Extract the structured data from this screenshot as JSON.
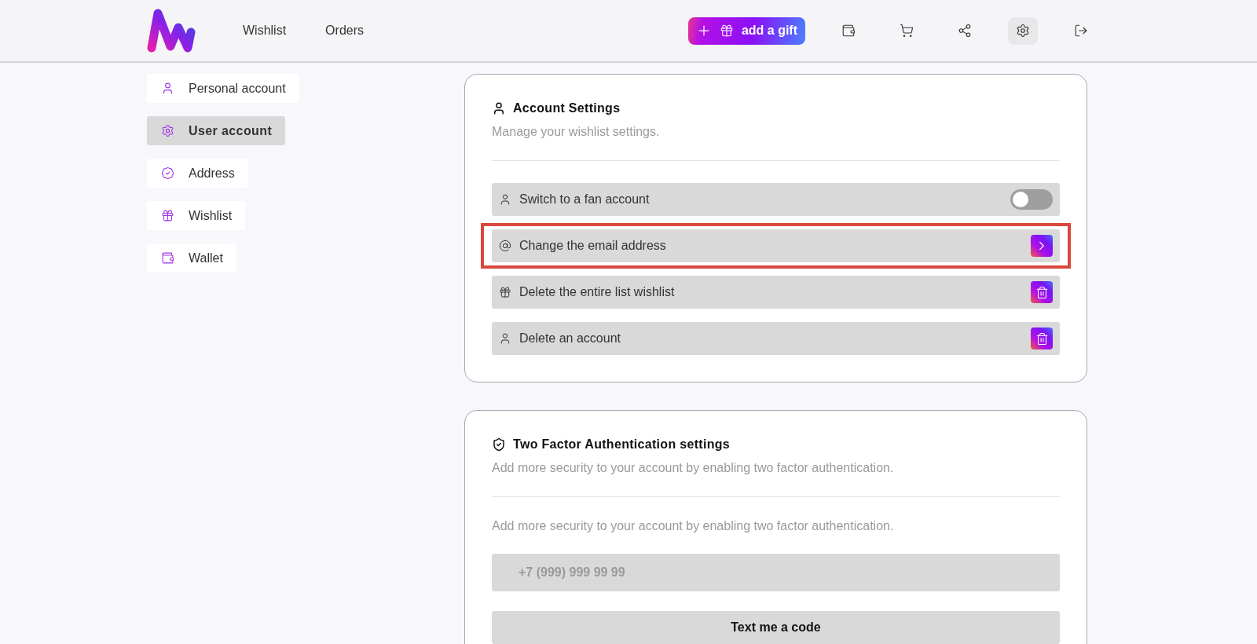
{
  "header": {
    "nav": [
      {
        "label": "Wishlist"
      },
      {
        "label": "Orders"
      }
    ],
    "add_button": {
      "label": "add a gift"
    },
    "toolbar": [
      {
        "kind": "wallet",
        "selected": false
      },
      {
        "kind": "cart",
        "selected": false
      },
      {
        "kind": "share",
        "selected": false
      },
      {
        "kind": "settings",
        "selected": true
      },
      {
        "kind": "logout",
        "selected": false
      }
    ]
  },
  "sidebar": {
    "items": [
      {
        "kind": "user",
        "label": "Personal account",
        "selected": false
      },
      {
        "kind": "settings",
        "label": "User account",
        "selected": true
      },
      {
        "kind": "badge",
        "label": "Address",
        "selected": false
      },
      {
        "kind": "gift",
        "label": "Wishlist",
        "selected": false
      },
      {
        "kind": "wallet",
        "label": "Wallet",
        "selected": false
      }
    ]
  },
  "account_settings": {
    "title": "Account Settings",
    "subtitle": "Manage your wishlist settings.",
    "rows": [
      {
        "kind": "toggle",
        "label": "Switch to a fan account",
        "on": false,
        "highlighted": false
      },
      {
        "kind": "arrow",
        "label": "Change the email address",
        "highlighted": true
      },
      {
        "kind": "delete",
        "label": "Delete the entire list wishlist",
        "highlighted": false
      },
      {
        "kind": "delete",
        "label": "Delete an account",
        "highlighted": false
      }
    ]
  },
  "two_factor": {
    "title": "Two Factor Authentication settings",
    "subtitle": "Add more security to your account by enabling two factor authentication.",
    "description": "Add more security to your account by enabling two factor authentication.",
    "phone": {
      "placeholder": "+7 (999) 999 99 99"
    },
    "button": "Text me a code"
  }
}
